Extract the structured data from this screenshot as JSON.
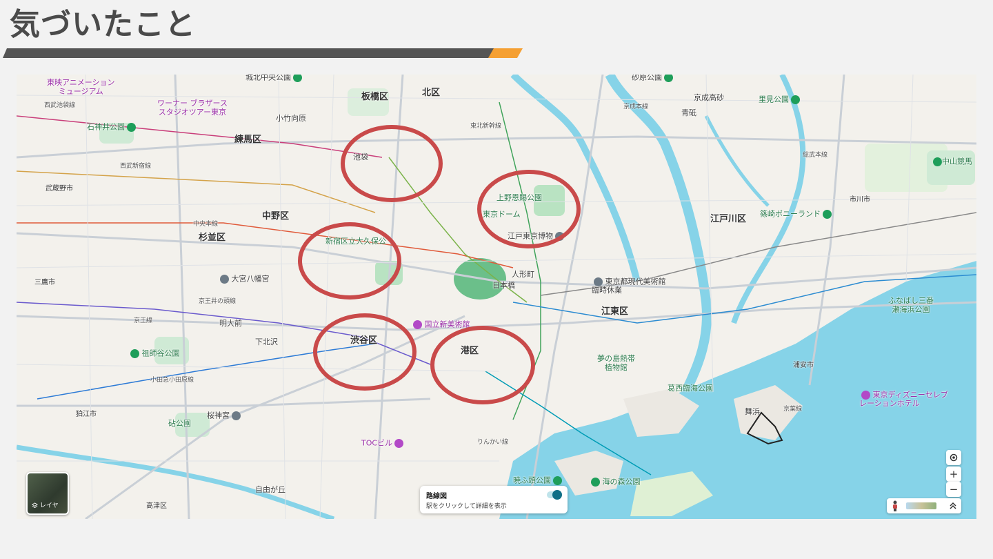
{
  "slide": {
    "title": "気づいたこと",
    "bar_dark_color": "#555555",
    "bar_accent_color": "#f5a033"
  },
  "map": {
    "wards": [
      "板橋区",
      "北区",
      "練馬区",
      "中野区",
      "杉並区",
      "渋谷区",
      "港区",
      "江東区",
      "江戸川区"
    ],
    "cities": [
      "武蔵野市",
      "三鷹市",
      "狛江市",
      "市川市",
      "浦安市"
    ],
    "places": {
      "toei_anim": "東映アニメーション\nミュージアム",
      "warner": "ワーナー ブラザース\nスタジオツアー東京",
      "shakujii": "石神井公園",
      "johoku": "城北中央公園",
      "sunahara": "砂原公園",
      "satomi": "里見公園",
      "nakayama": "中山競馬",
      "ueno": "上野恩賜公園",
      "tokyo_dome": "東京ドーム",
      "edo_museum": "江戸東京博物",
      "shinjuku_park": "新宿区立大久保公",
      "omiya_hachimangu": "大宮八幡宮",
      "mot": "東京都現代美術館\n臨時休業",
      "nact": "国立新美術館",
      "soshigaya": "祖師谷公園",
      "yume_no_shima": "夢の島熱帯\n植物館",
      "kasai": "葛西臨海公園",
      "shinonome": "篠崎ポニーランド",
      "funabashi": "ふなばし三番\n瀬海浜公園",
      "disney_hotel": "東京ディズニーセレブ\nレーションホテル",
      "kinuta": "砧公園",
      "sakurajingu": "桜神宮",
      "toc": "TOCビル",
      "akatsuki": "暁ふ頭公園",
      "uminomori": "海の森公園",
      "jiyugaoka": "自由が丘",
      "takatsu": "高津区",
      "ikebukuro": "池袋",
      "nihonbashi": "日本橋",
      "ningyocho": "人形町",
      "shimokitazawa": "下北沢",
      "meidaimae": "明大前",
      "kotake": "小竹向原",
      "keisei_takasago": "京成高砂",
      "aoto": "青砥",
      "maihama": "舞浜",
      "rinkai": "りんかい線"
    },
    "rail_labels": [
      "西武池袋線",
      "西武新宿線",
      "中央本線",
      "京王井の頭線",
      "京王線",
      "小田急小田原線",
      "京成本線",
      "総武本線",
      "東北新幹線",
      "京葉線"
    ],
    "route_card": {
      "title": "路線図",
      "subtitle": "駅をクリックして詳細を表示"
    },
    "layer_button": "レイヤ",
    "zoom_in": "+",
    "zoom_out": "−",
    "circle_color": "#c94a4a"
  }
}
